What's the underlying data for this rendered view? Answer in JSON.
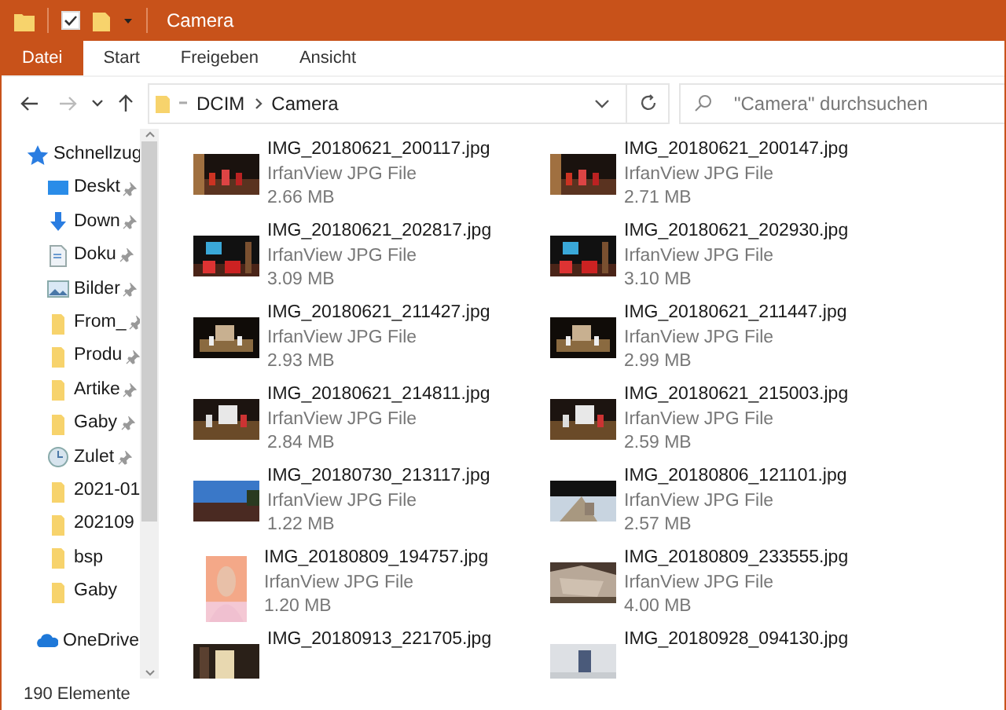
{
  "window": {
    "title": "Camera"
  },
  "ribbon_tabs": [
    {
      "label": "Datei",
      "selected": true
    },
    {
      "label": "Start",
      "selected": false
    },
    {
      "label": "Freigeben",
      "selected": false
    },
    {
      "label": "Ansicht",
      "selected": false
    }
  ],
  "breadcrumb": [
    "DCIM",
    "Camera"
  ],
  "search": {
    "placeholder": "\"Camera\" durchsuchen"
  },
  "sidebar": {
    "items": [
      {
        "label": "Schnellzug",
        "kind": "star",
        "pinned": false
      },
      {
        "label": "Deskt",
        "kind": "desktop",
        "pinned": true
      },
      {
        "label": "Down",
        "kind": "download",
        "pinned": true
      },
      {
        "label": "Doku",
        "kind": "document",
        "pinned": true
      },
      {
        "label": "Bilder",
        "kind": "pictures",
        "pinned": true
      },
      {
        "label": "From_",
        "kind": "folder",
        "pinned": true
      },
      {
        "label": "Produ",
        "kind": "folder",
        "pinned": true
      },
      {
        "label": "Artike",
        "kind": "folder",
        "pinned": true
      },
      {
        "label": "Gaby",
        "kind": "folder",
        "pinned": true
      },
      {
        "label": "Zulet",
        "kind": "recent",
        "pinned": true
      },
      {
        "label": "2021-01",
        "kind": "folder",
        "pinned": false
      },
      {
        "label": "202109",
        "kind": "folder",
        "pinned": false
      },
      {
        "label": "bsp",
        "kind": "folder",
        "pinned": false
      },
      {
        "label": "Gaby",
        "kind": "folder",
        "pinned": false
      },
      {
        "label": "OneDrive",
        "kind": "cloud",
        "pinned": false
      }
    ]
  },
  "files": [
    {
      "name": "IMG_20180621_200117.jpg",
      "type": "IrfanView JPG File",
      "size": "2.66 MB"
    },
    {
      "name": "IMG_20180621_200147.jpg",
      "type": "IrfanView JPG File",
      "size": "2.71 MB"
    },
    {
      "name": "IMG_20180621_202817.jpg",
      "type": "IrfanView JPG File",
      "size": "3.09 MB"
    },
    {
      "name": "IMG_20180621_202930.jpg",
      "type": "IrfanView JPG File",
      "size": "3.10 MB"
    },
    {
      "name": "IMG_20180621_211427.jpg",
      "type": "IrfanView JPG File",
      "size": "2.93 MB"
    },
    {
      "name": "IMG_20180621_211447.jpg",
      "type": "IrfanView JPG File",
      "size": "2.99 MB"
    },
    {
      "name": "IMG_20180621_214811.jpg",
      "type": "IrfanView JPG File",
      "size": "2.84 MB"
    },
    {
      "name": "IMG_20180621_215003.jpg",
      "type": "IrfanView JPG File",
      "size": "2.59 MB"
    },
    {
      "name": "IMG_20180730_213117.jpg",
      "type": "IrfanView JPG File",
      "size": "1.22 MB"
    },
    {
      "name": "IMG_20180806_121101.jpg",
      "type": "IrfanView JPG File",
      "size": "2.57 MB"
    },
    {
      "name": "IMG_20180809_194757.jpg",
      "type": "IrfanView JPG File",
      "size": "1.20 MB"
    },
    {
      "name": "IMG_20180809_233555.jpg",
      "type": "IrfanView JPG File",
      "size": "4.00 MB"
    },
    {
      "name": "IMG_20180913_221705.jpg"
    },
    {
      "name": "IMG_20180928_094130.jpg"
    }
  ],
  "status_bar": {
    "count": "190 Elemente"
  }
}
